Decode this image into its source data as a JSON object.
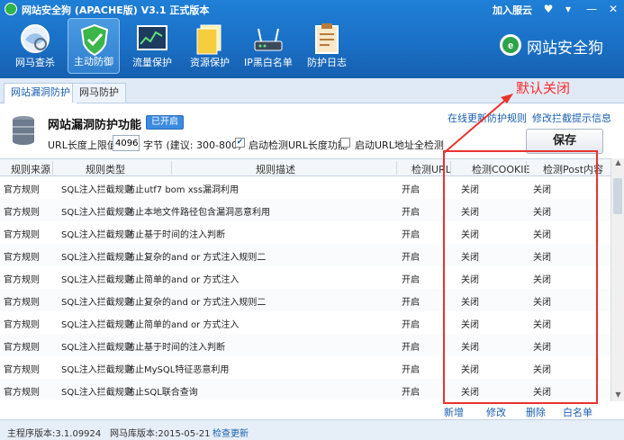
{
  "titlebar": {
    "title": "网站安全狗 (APACHE版) V3.1 正式版本",
    "join_cloud": "加入服云",
    "minimize": "—",
    "close": "✕",
    "menu": "▾",
    "shirt": "♥"
  },
  "nav": [
    {
      "label": "网马查杀",
      "icon": "globe-scan-icon"
    },
    {
      "label": "主动防御",
      "icon": "shield-icon"
    },
    {
      "label": "流量保护",
      "icon": "traffic-chart-icon"
    },
    {
      "label": "资源保护",
      "icon": "folder-icon"
    },
    {
      "label": "IP黑白名单",
      "icon": "router-icon"
    },
    {
      "label": "防护日志",
      "icon": "clipboard-icon"
    }
  ],
  "brand": {
    "text": "网站安全狗"
  },
  "tabs": [
    {
      "label": "网站漏洞防护",
      "active": true
    },
    {
      "label": "网马防护",
      "active": false
    }
  ],
  "feature": {
    "title": "网站漏洞防护功能",
    "status_badge": "已开启",
    "link_update": "在线更新防护规则",
    "link_modify": "修改拦截提示信息",
    "url_limit_label": "URL长度上限值:",
    "url_limit_value": "4096",
    "url_limit_note": "字节 (建议: 300-800)",
    "check_url_length_label": "启动检测URL长度功能",
    "check_url_length_checked": true,
    "check_url_full_label": "启动URL地址全检测",
    "check_url_full_checked": false,
    "save_label": "保存"
  },
  "annotation": {
    "text": "默认关闭"
  },
  "table": {
    "columns": [
      "规则来源",
      "规则类型",
      "规则描述",
      "检测URL",
      "检测COOKIE",
      "检测Post内容"
    ],
    "rows": [
      [
        "官方规则",
        "SQL注入拦截规则",
        "防止utf7 bom xss漏洞利用",
        "开启",
        "关闭",
        "关闭"
      ],
      [
        "官方规则",
        "SQL注入拦截规则",
        "防止本地文件路径包含漏洞恶意利用",
        "开启",
        "关闭",
        "关闭"
      ],
      [
        "官方规则",
        "SQL注入拦截规则",
        "防止基于时间的注入判断",
        "开启",
        "关闭",
        "关闭"
      ],
      [
        "官方规则",
        "SQL注入拦截规则",
        "防止复杂的and or 方式注入规则二",
        "开启",
        "关闭",
        "关闭"
      ],
      [
        "官方规则",
        "SQL注入拦截规则",
        "防止简单的and or 方式注入",
        "开启",
        "关闭",
        "关闭"
      ],
      [
        "官方规则",
        "SQL注入拦截规则",
        "防止复杂的and or 方式注入规则二",
        "开启",
        "关闭",
        "关闭"
      ],
      [
        "官方规则",
        "SQL注入拦截规则",
        "防止简单的and or 方式注入",
        "开启",
        "关闭",
        "关闭"
      ],
      [
        "官方规则",
        "SQL注入拦截规则",
        "防止基于时间的注入判断",
        "开启",
        "关闭",
        "关闭"
      ],
      [
        "官方规则",
        "SQL注入拦截规则",
        "防止MySQL特征恶意利用",
        "开启",
        "关闭",
        "关闭"
      ],
      [
        "官方规则",
        "SQL注入拦截规则",
        "防止SQL联合查询",
        "开启",
        "关闭",
        "关闭"
      ]
    ]
  },
  "actions": {
    "add": "新增",
    "edit": "修改",
    "delete": "删除",
    "whitelist": "白名单"
  },
  "status": {
    "main_version": "主程序版本:3.1.09924",
    "db_version": "网马库版本:2015-05-21",
    "check_update": "检查更新"
  },
  "colors": {
    "accent": "#1a6fc4",
    "annotation": "#e8332e",
    "link": "#1a5fb0"
  }
}
